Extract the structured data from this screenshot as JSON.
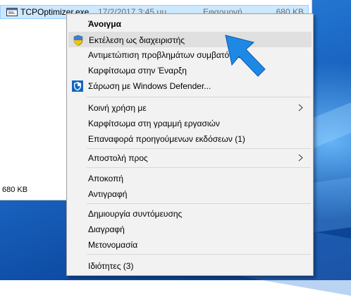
{
  "explorer": {
    "file": {
      "name": "TCPOptimizer.exe",
      "date": "17/2/2017 3:45 μμ",
      "type": "Εφαρμογή",
      "size": "680 KB"
    },
    "status_size": "680 KB"
  },
  "context_menu": {
    "open": "Άνοιγμα",
    "run_as_admin": "Εκτέλεση ως διαχειριστής",
    "troubleshoot": "Αντιμετώπιση προβλημάτων συμβατότητας",
    "pin_start": "Καρφίτσωμα στην Έναρξη",
    "defender_scan": "Σάρωση με Windows Defender...",
    "share_with": "Κοινή χρήση με",
    "pin_taskbar": "Καρφίτσωμα στη γραμμή εργασιών",
    "restore_versions": "Επαναφορά προηγούμενων εκδόσεων (1)",
    "send_to": "Αποστολή προς",
    "cut": "Αποκοπή",
    "copy": "Αντιγραφή",
    "create_shortcut": "Δημιουργία συντόμευσης",
    "delete": "Διαγραφή",
    "rename": "Μετονομασία",
    "properties": "Ιδιότητες (3)"
  },
  "colors": {
    "selection": "#cce8ff",
    "menu_bg": "#f2f2f2",
    "hover": "#e0e0e0",
    "pointer": "#1e88e5"
  }
}
